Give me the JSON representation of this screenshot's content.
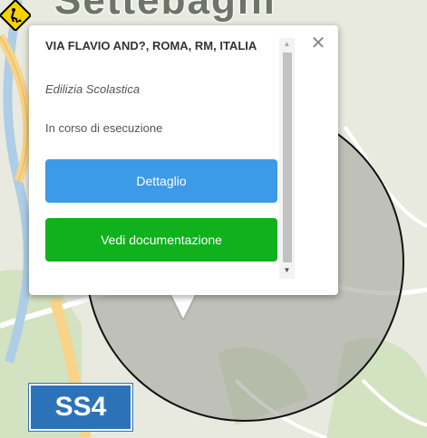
{
  "map": {
    "place_label": "Settebagni",
    "road_shield": "SS4",
    "colors": {
      "background": "#e8eadf",
      "circle_fill": "#a3a39f",
      "road_yellow": "#f7d48a",
      "road_blue": "#2c72b9",
      "parks": "#c4dca8"
    },
    "marker_icon": "roadworks-icon"
  },
  "popup": {
    "address": "VIA FLAVIO AND?, ROMA, RM, ITALIA",
    "category": "Edilizia Scolastica",
    "status": "In corso di esecuzione",
    "detail_button": "Dettaglio",
    "docs_button": "Vedi documentazione",
    "close_icon": "close-icon",
    "colors": {
      "detail": "#3d9ae8",
      "docs": "#0fb11c"
    }
  }
}
